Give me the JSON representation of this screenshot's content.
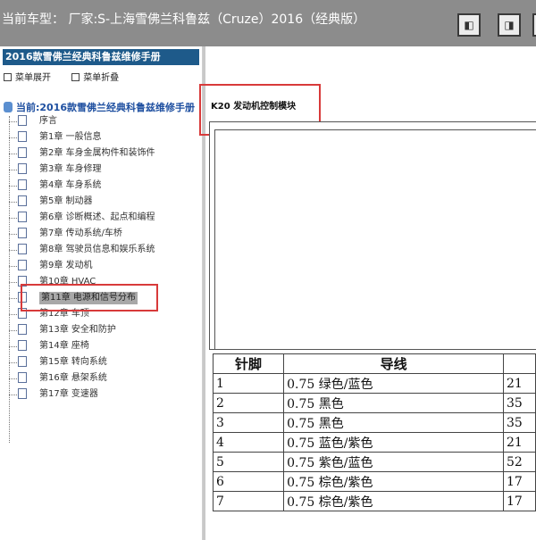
{
  "header": {
    "title": "当前车型： 厂家:S-上海雪佛兰科鲁兹（Cruze）2016（经典版）",
    "buttons": [
      "panel-left-icon",
      "split-view-icon",
      "panel-right-icon"
    ]
  },
  "sidebar": {
    "book_title": "2016款雪佛兰经典科鲁兹维修手册",
    "expand_label": "菜单展开",
    "collapse_label": "菜单折叠",
    "current_label": "当前:2016款雪佛兰经典科鲁兹维修手册",
    "items": [
      {
        "label": "序言"
      },
      {
        "label": "第1章 一般信息"
      },
      {
        "label": "第2章 车身金属构件和装饰件"
      },
      {
        "label": "第3章 车身修理"
      },
      {
        "label": "第4章 车身系统"
      },
      {
        "label": "第5章 制动器"
      },
      {
        "label": "第6章 诊断概述、起点和编程"
      },
      {
        "label": "第7章 传动系统/车桥"
      },
      {
        "label": "第8章 驾驶员信息和娱乐系统"
      },
      {
        "label": "第9章 发动机"
      },
      {
        "label": "第10章 HVAC"
      },
      {
        "label": "第11章 电源和信号分布"
      },
      {
        "label": "第12章 车顶"
      },
      {
        "label": "第13章 安全和防护"
      },
      {
        "label": "第14章 座椅"
      },
      {
        "label": "第15章 转向系统"
      },
      {
        "label": "第16章 悬架系统"
      },
      {
        "label": "第17章 变速器"
      }
    ],
    "selected_index": 11
  },
  "main": {
    "module_title": "K20 发动机控制模块",
    "table": {
      "headers": [
        "针脚",
        "导线",
        ""
      ],
      "rows": [
        [
          "1",
          "0.75 绿色/蓝色",
          "21"
        ],
        [
          "2",
          "0.75 黑色",
          "35"
        ],
        [
          "3",
          "0.75 黑色",
          "35"
        ],
        [
          "4",
          "0.75 蓝色/紫色",
          "21"
        ],
        [
          "5",
          "0.75 紫色/蓝色",
          "52"
        ],
        [
          "6",
          "0.75 棕色/紫色",
          "17"
        ],
        [
          "7",
          "0.75 棕色/紫色",
          "17"
        ]
      ]
    }
  },
  "colors": {
    "topbar": "#8c8c8c",
    "book_title_bg": "#1e5a8a",
    "highlight": "#d83a3a",
    "selected_bg": "#a8a8a8"
  }
}
